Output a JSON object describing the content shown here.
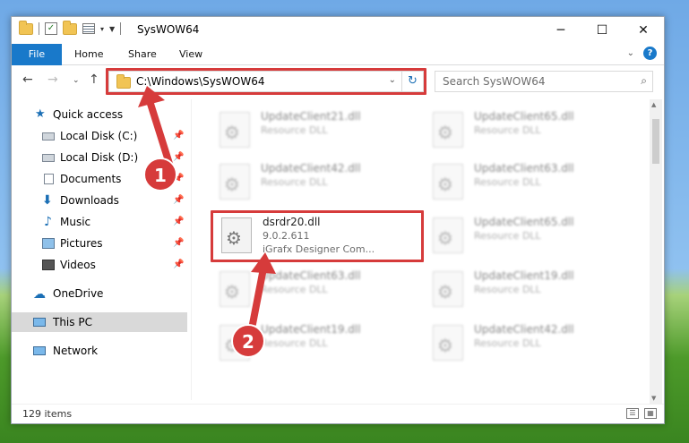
{
  "window": {
    "title": "SysWOW64",
    "minimize": "─",
    "maximize": "☐",
    "close": "✕"
  },
  "ribbon": {
    "tabs": [
      "File",
      "Home",
      "Share",
      "View"
    ]
  },
  "address": {
    "path": "C:\\Windows\\SysWOW64",
    "search_placeholder": "Search SysWOW64"
  },
  "nav": {
    "items": [
      {
        "label": "Quick access",
        "icon": "star-icon"
      },
      {
        "label": "Local Disk (C:)",
        "icon": "drive-icon",
        "pinned": true
      },
      {
        "label": "Local Disk (D:)",
        "icon": "drive-icon",
        "pinned": true
      },
      {
        "label": "Documents",
        "icon": "documents-icon",
        "pinned": true
      },
      {
        "label": "Downloads",
        "icon": "downloads-icon",
        "pinned": true
      },
      {
        "label": "Music",
        "icon": "music-icon",
        "pinned": true
      },
      {
        "label": "Pictures",
        "icon": "pictures-icon",
        "pinned": true
      },
      {
        "label": "Videos",
        "icon": "videos-icon",
        "pinned": true
      },
      {
        "label": "OneDrive",
        "icon": "cloud-icon"
      },
      {
        "label": "This PC",
        "icon": "pc-icon",
        "selected": true
      },
      {
        "label": "Network",
        "icon": "network-icon"
      }
    ]
  },
  "files": [
    {
      "name": "UpdateClient21.dll",
      "desc": "Resource DLL"
    },
    {
      "name": "UpdateClient65.dll",
      "desc": "Resource DLL"
    },
    {
      "name": "UpdateClient42.dll",
      "desc": "Resource DLL"
    },
    {
      "name": "UpdateClient63.dll",
      "desc": "Resource DLL"
    },
    {
      "name": "dsrdr20.dll",
      "version": "9.0.2.611",
      "desc": "iGrafx Designer Com..."
    },
    {
      "name": "UpdateClient65.dll",
      "desc": "Resource DLL"
    },
    {
      "name": "UpdateClient63.dll",
      "desc": "Resource DLL"
    },
    {
      "name": "UpdateClient19.dll",
      "desc": "Resource DLL"
    },
    {
      "name": "UpdateClient19.dll",
      "desc": "Resource DLL"
    },
    {
      "name": "UpdateClient42.dll",
      "desc": "Resource DLL"
    }
  ],
  "status": {
    "item_count": "129 items"
  },
  "annotations": {
    "step1": "1",
    "step2": "2",
    "accent": "#d63b3b"
  }
}
